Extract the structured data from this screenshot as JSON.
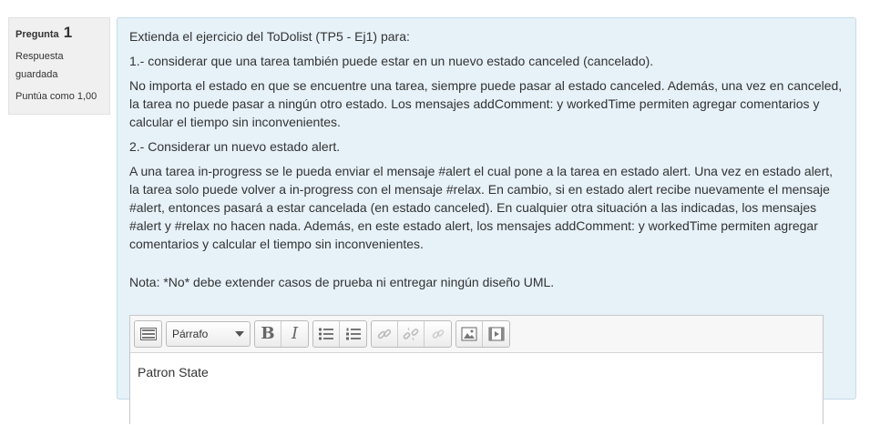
{
  "question": {
    "label": "Pregunta",
    "number": "1",
    "state": "Respuesta guardada",
    "grade": "Puntúa como 1,00"
  },
  "content": {
    "p1": "Extienda el ejercicio del ToDolist (TP5 - Ej1) para:",
    "p2": "1.- considerar que una tarea también puede estar en un nuevo estado canceled (cancelado).",
    "p3": "No importa el estado en que se encuentre una tarea, siempre puede pasar al estado canceled. Además, una vez en canceled, la tarea no puede pasar a ningún otro estado. Los mensajes  addComment: y workedTime permiten agregar comentarios y calcular el tiempo sin inconvenientes.",
    "p4": "2.- Considerar un nuevo estado alert.",
    "p5": "A una tarea in-progress se le pueda enviar el mensaje #alert el cual pone a la tarea en estado alert. Una vez en estado alert, la tarea solo puede volver a in-progress con el mensaje #relax. En cambio, si en estado alert recibe nuevamente el mensaje #alert, entonces pasará a estar cancelada (en estado canceled). En cualquier otra situación a las indicadas, los mensajes #alert y #relax no hacen nada. Además, en este estado alert, los mensajes addComment: y workedTime permiten agregar comentarios y calcular el tiempo sin inconvenientes.",
    "nota": "Nota: *No* debe extender casos de prueba ni entregar ningún diseño UML."
  },
  "editor": {
    "format_value": "Párrafo",
    "bold_label": "B",
    "italic_label": "I",
    "text": "Patron State"
  },
  "colors": {
    "content_bg": "#e6f1f8",
    "info_bg": "#f0f0f0"
  }
}
